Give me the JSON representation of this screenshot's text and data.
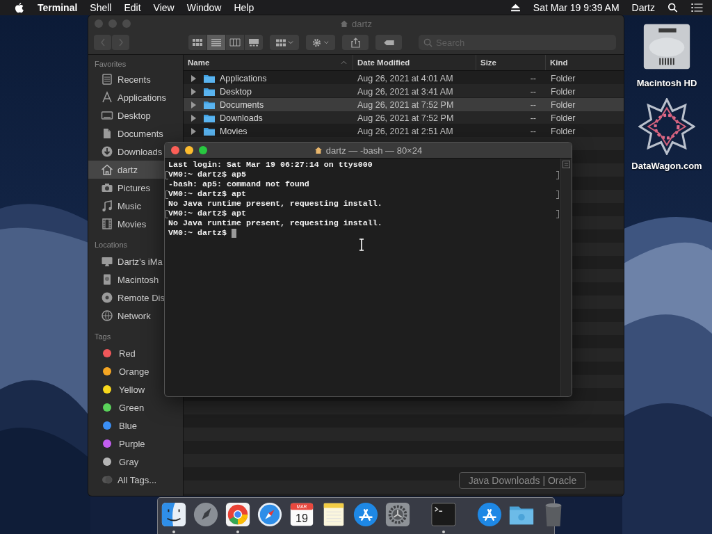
{
  "menubar": {
    "app_name": "Terminal",
    "menus": [
      "Shell",
      "Edit",
      "View",
      "Window",
      "Help"
    ],
    "clock": "Sat Mar 19 9:39 AM",
    "user": "Dartz"
  },
  "finder": {
    "title": "dartz",
    "views": [
      {
        "selected": false
      },
      {
        "selected": true
      },
      {
        "selected": false
      },
      {
        "selected": false
      }
    ],
    "search": {
      "placeholder": "Search"
    },
    "favorites": {
      "heading": "Favorites",
      "items": [
        {
          "label": "Recents",
          "selected": false
        },
        {
          "label": "Applications",
          "selected": false
        },
        {
          "label": "Desktop",
          "selected": false
        },
        {
          "label": "Documents",
          "selected": false
        },
        {
          "label": "Downloads",
          "selected": false
        },
        {
          "label": "dartz",
          "selected": true
        },
        {
          "label": "Pictures",
          "selected": false
        },
        {
          "label": "Music",
          "selected": false
        },
        {
          "label": "Movies",
          "selected": false
        }
      ]
    },
    "locations": {
      "heading": "Locations",
      "items": [
        {
          "label": "Dartz’s iMa",
          "selected": false
        },
        {
          "label": "Macintosh",
          "selected": false
        },
        {
          "label": "Remote Dis",
          "selected": false
        },
        {
          "label": "Network",
          "selected": false
        }
      ]
    },
    "tags": {
      "heading": "Tags",
      "items": [
        {
          "label": "Red",
          "color": "#f0575a"
        },
        {
          "label": "Orange",
          "color": "#f5a623"
        },
        {
          "label": "Yellow",
          "color": "#f8d81c"
        },
        {
          "label": "Green",
          "color": "#5ad25a"
        },
        {
          "label": "Blue",
          "color": "#3b8ff5"
        },
        {
          "label": "Purple",
          "color": "#c35ef0"
        },
        {
          "label": "Gray",
          "color": "#b5b5b5"
        }
      ],
      "all_label": "All Tags..."
    },
    "columns": [
      {
        "label": "Name",
        "sorted": true
      },
      {
        "label": "Date Modified",
        "sorted": false
      },
      {
        "label": "Size",
        "sorted": false
      },
      {
        "label": "Kind",
        "sorted": false
      }
    ],
    "rows": [
      {
        "name": "Applications",
        "date": "Aug 26, 2021 at 4:01 AM",
        "size": "--",
        "kind": "Folder",
        "selected": false
      },
      {
        "name": "Desktop",
        "date": "Aug 26, 2021 at 3:41 AM",
        "size": "--",
        "kind": "Folder",
        "selected": false
      },
      {
        "name": "Documents",
        "date": "Aug 26, 2021 at 7:52 PM",
        "size": "--",
        "kind": "Folder",
        "selected": true
      },
      {
        "name": "Downloads",
        "date": "Aug 26, 2021 at 7:52 PM",
        "size": "--",
        "kind": "Folder",
        "selected": false
      },
      {
        "name": "Movies",
        "date": "Aug 26, 2021 at 2:51 AM",
        "size": "--",
        "kind": "Folder",
        "selected": false
      }
    ]
  },
  "terminal": {
    "title": "dartz — -bash — 80×24",
    "lines": [
      {
        "text": "Last login: Sat Mar 19 06:27:14 on ttys000",
        "marked": false
      },
      {
        "text": "VM0:~ dartz$ ap5",
        "marked": true
      },
      {
        "text": "-bash: ap5: command not found",
        "marked": false
      },
      {
        "text": "VM0:~ dartz$ apt",
        "marked": true
      },
      {
        "text": "No Java runtime present, requesting install.",
        "marked": false
      },
      {
        "text": "VM0:~ dartz$ apt",
        "marked": true
      },
      {
        "text": "No Java runtime present, requesting install.",
        "marked": false
      },
      {
        "text": "VM0:~ dartz$ ",
        "marked": false
      }
    ],
    "cursor": true
  },
  "desktop_icons": [
    {
      "label": "Macintosh HD",
      "kind": "disk"
    },
    {
      "label": "DataWagon.com",
      "kind": "star"
    }
  ],
  "dock": {
    "items": [
      {
        "kind": "finder",
        "running": true
      },
      {
        "kind": "launchpad",
        "running": false
      },
      {
        "kind": "chrome",
        "running": true
      },
      {
        "kind": "safari",
        "running": false
      },
      {
        "kind": "calendar",
        "running": false,
        "month": "MAR",
        "day": "19"
      },
      {
        "kind": "notes",
        "running": false
      },
      {
        "kind": "appstore",
        "running": false
      },
      {
        "kind": "prefs",
        "running": false
      },
      {
        "kind": "separator"
      },
      {
        "kind": "terminal",
        "running": true
      },
      {
        "kind": "separator"
      },
      {
        "kind": "appstore",
        "running": false
      },
      {
        "kind": "folder",
        "running": false
      },
      {
        "kind": "trash",
        "running": false
      }
    ]
  },
  "tooltip": "Java Downloads | Oracle"
}
